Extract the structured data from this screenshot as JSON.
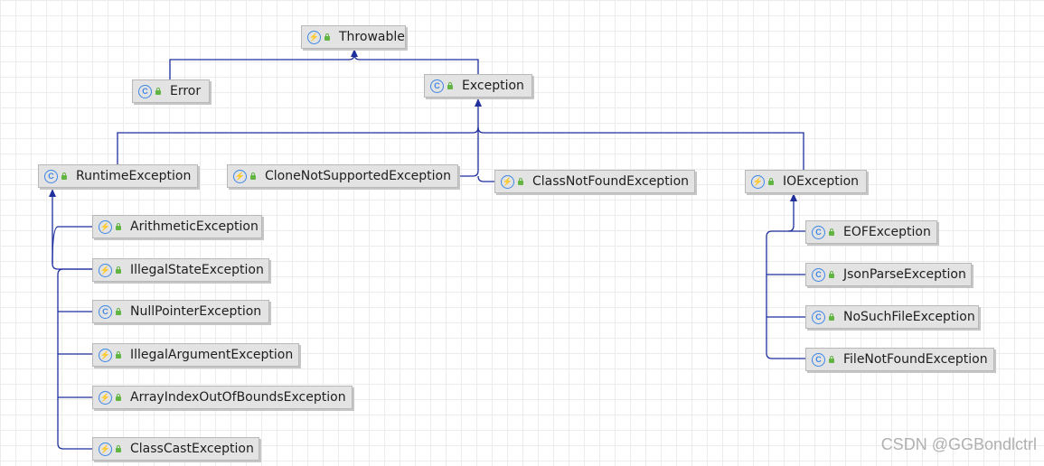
{
  "diagram": {
    "nodes": {
      "throwable": {
        "label": "Throwable",
        "kind": "abstract-class"
      },
      "error": {
        "label": "Error",
        "kind": "class"
      },
      "exception": {
        "label": "Exception",
        "kind": "class"
      },
      "runtime_exception": {
        "label": "RuntimeException",
        "kind": "class"
      },
      "clone_not_supported_exception": {
        "label": "CloneNotSupportedException",
        "kind": "abstract-class"
      },
      "class_not_found_exception": {
        "label": "ClassNotFoundException",
        "kind": "abstract-class"
      },
      "io_exception": {
        "label": "IOException",
        "kind": "abstract-class"
      },
      "arithmetic_exception": {
        "label": "ArithmeticException",
        "kind": "abstract-class"
      },
      "illegal_state_exception": {
        "label": "IllegalStateException",
        "kind": "abstract-class"
      },
      "null_pointer_exception": {
        "label": "NullPointerException",
        "kind": "class"
      },
      "illegal_argument_exception": {
        "label": "IllegalArgumentException",
        "kind": "abstract-class"
      },
      "array_index_out_of_bounds_exception": {
        "label": "ArrayIndexOutOfBoundsException",
        "kind": "abstract-class"
      },
      "class_cast_exception": {
        "label": "ClassCastException",
        "kind": "abstract-class"
      },
      "eof_exception": {
        "label": "EOFException",
        "kind": "class"
      },
      "json_parse_exception": {
        "label": "JsonParseException",
        "kind": "class"
      },
      "no_such_file_exception": {
        "label": "NoSuchFileException",
        "kind": "class"
      },
      "file_not_found_exception": {
        "label": "FileNotFoundException",
        "kind": "class"
      }
    },
    "edges": [
      {
        "from": "error",
        "to": "throwable"
      },
      {
        "from": "exception",
        "to": "throwable"
      },
      {
        "from": "runtime_exception",
        "to": "exception"
      },
      {
        "from": "clone_not_supported_exception",
        "to": "exception"
      },
      {
        "from": "class_not_found_exception",
        "to": "exception"
      },
      {
        "from": "io_exception",
        "to": "exception"
      },
      {
        "from": "arithmetic_exception",
        "to": "runtime_exception"
      },
      {
        "from": "illegal_state_exception",
        "to": "runtime_exception"
      },
      {
        "from": "null_pointer_exception",
        "to": "runtime_exception"
      },
      {
        "from": "illegal_argument_exception",
        "to": "runtime_exception"
      },
      {
        "from": "array_index_out_of_bounds_exception",
        "to": "runtime_exception"
      },
      {
        "from": "class_cast_exception",
        "to": "runtime_exception"
      },
      {
        "from": "eof_exception",
        "to": "io_exception"
      },
      {
        "from": "json_parse_exception",
        "to": "io_exception"
      },
      {
        "from": "no_such_file_exception",
        "to": "io_exception"
      },
      {
        "from": "file_not_found_exception",
        "to": "io_exception"
      }
    ],
    "colors": {
      "edge": "#1f2f9e",
      "node_fill": "#e3e3e3",
      "icon": "#3d86e6",
      "lock": "#62b543"
    },
    "icons": {
      "class": "class-icon",
      "abstract-class": "abstract-class-icon",
      "visibility": "lock-icon"
    }
  },
  "watermark": "CSDN @GGBondlctrl"
}
